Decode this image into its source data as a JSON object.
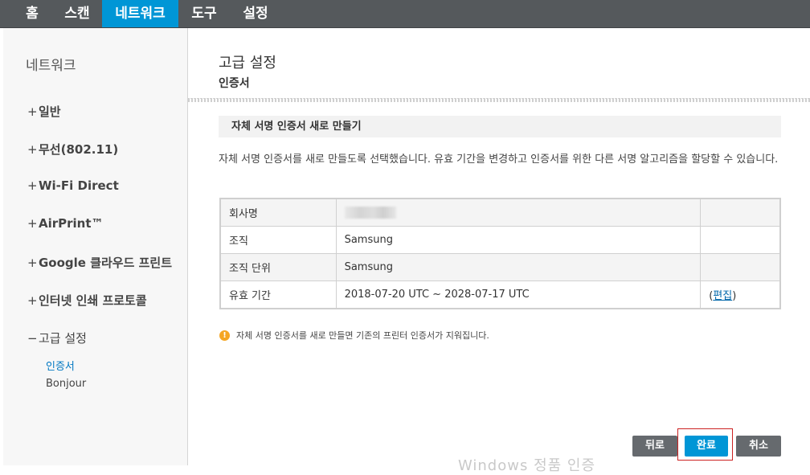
{
  "topnav": {
    "tabs": [
      {
        "label": "홈"
      },
      {
        "label": "스캔"
      },
      {
        "label": "네트워크"
      },
      {
        "label": "도구"
      },
      {
        "label": "설정"
      }
    ]
  },
  "sidebar": {
    "title": "네트워크",
    "items": [
      {
        "sign": "+",
        "label": "일반"
      },
      {
        "sign": "+",
        "label": "무선(802.11)"
      },
      {
        "sign": "+",
        "label": "Wi-Fi Direct"
      },
      {
        "sign": "+",
        "label": "AirPrint™"
      },
      {
        "sign": "+",
        "label": "Google 클라우드 프린트"
      },
      {
        "sign": "+",
        "label": "인터넷 인쇄 프로토콜"
      },
      {
        "sign": "−",
        "label": "고급 설정"
      }
    ],
    "subitems": [
      {
        "label": "인증서"
      },
      {
        "label": "Bonjour"
      }
    ]
  },
  "main": {
    "title": "고급 설정",
    "subtitle": "인증서",
    "section_header": "자체 서명 인증서 새로 만들기",
    "description": "자체 서명 인증서를 새로 만들도록 선택했습니다. 유효 기간을 변경하고 인증서를 위한 다른 서명 알고리즘을 할당할 수 있습니다.",
    "table": {
      "rows": [
        {
          "label": "회사명",
          "value": ""
        },
        {
          "label": "조직",
          "value": "Samsung"
        },
        {
          "label": "조직 단위",
          "value": "Samsung"
        },
        {
          "label": "유효 기간",
          "value": "2018-07-20 UTC ~ 2028-07-17 UTC",
          "action_open": "(",
          "action": "편집",
          "action_close": ")"
        }
      ]
    },
    "notice": "자체 서명 인증서를 새로 만들면 기존의 프린터 인증서가 지워집니다.",
    "notice_icon": "!"
  },
  "buttons": {
    "back": "뒤로",
    "done": "완료",
    "cancel": "취소"
  },
  "watermark": "Windows 정품 인증",
  "colors": {
    "nav_bg": "#55595c",
    "accent": "#0096d6",
    "button_gray": "#666a6e",
    "link": "#0066aa",
    "warning": "#f5a623"
  }
}
